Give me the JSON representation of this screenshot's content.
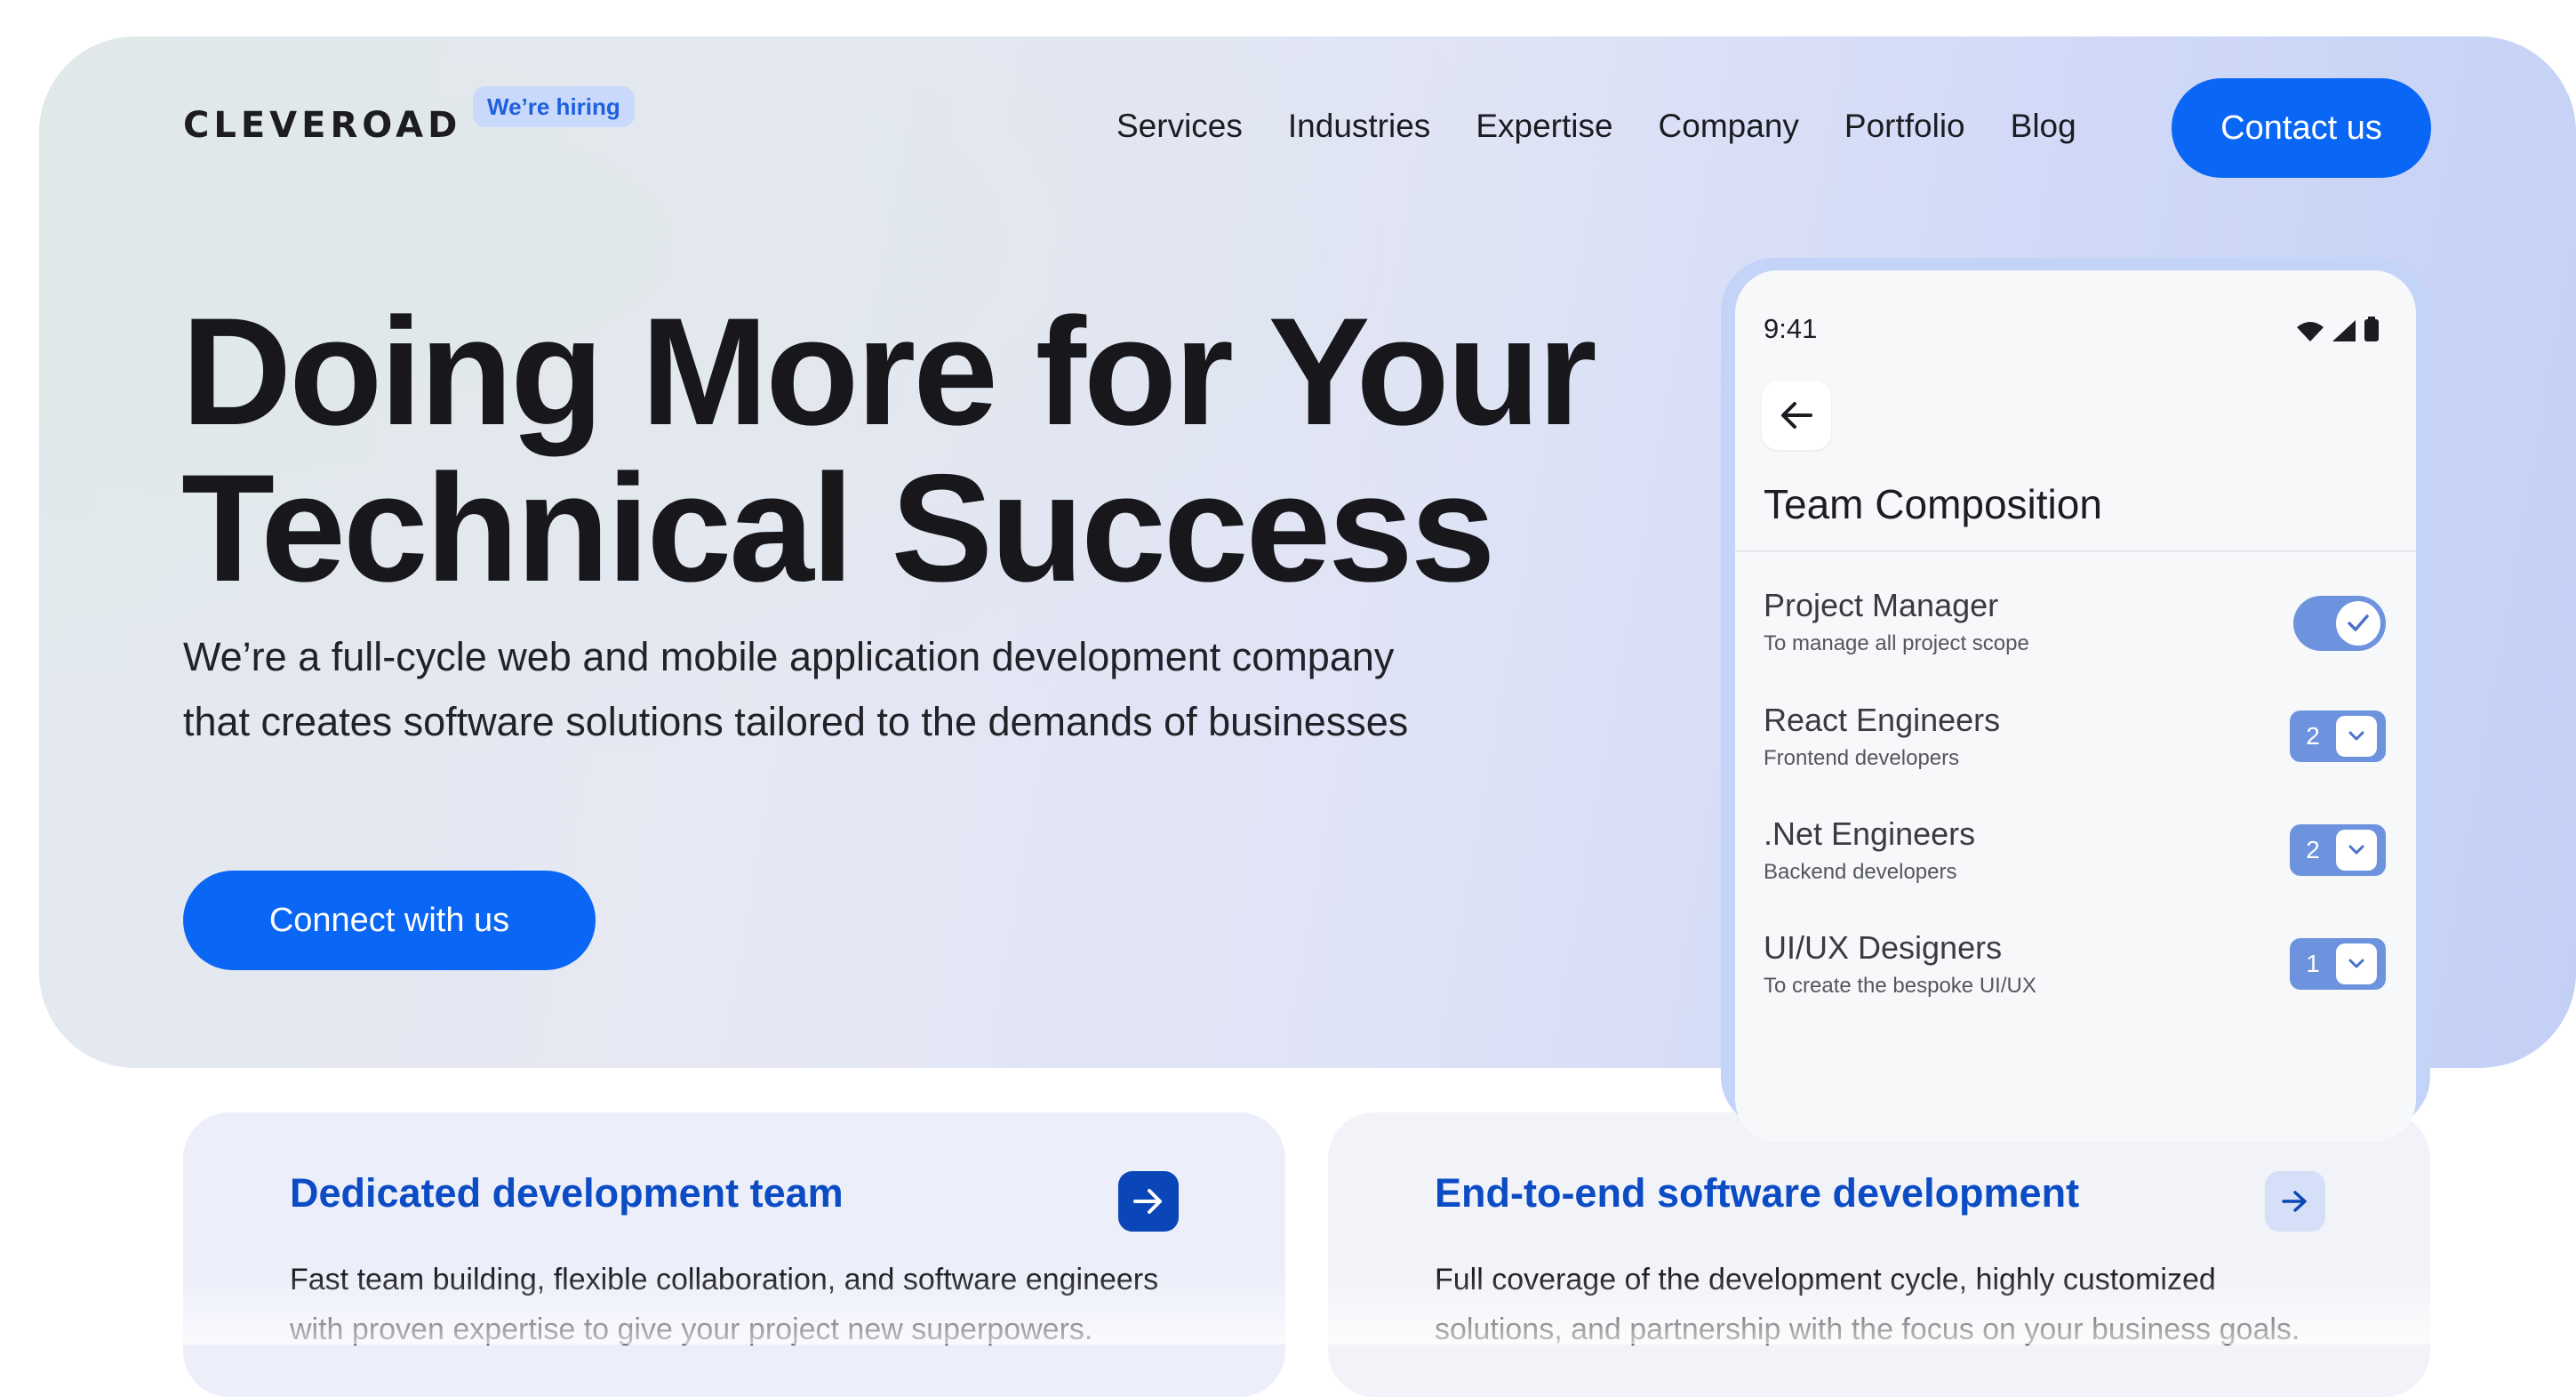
{
  "header": {
    "logo": "CLEVEROAD",
    "hiring_badge": "We’re hiring",
    "nav": [
      "Services",
      "Industries",
      "Expertise",
      "Company",
      "Portfolio",
      "Blog"
    ],
    "contact_label": "Contact us"
  },
  "hero": {
    "title_line1": "Doing More for Your",
    "title_line2": "Technical Success",
    "subtitle_line1": "We’re a full-cycle web and mobile application development company",
    "subtitle_line2": "that creates software solutions tailored to the demands of businesses",
    "cta_label": "Connect with us"
  },
  "phone": {
    "time": "9:41",
    "title": "Team Composition",
    "roles": [
      {
        "name": "Project Manager",
        "desc": "To manage all project scope",
        "control": "toggle",
        "checked": true
      },
      {
        "name": "React Engineers",
        "desc": "Frontend developers",
        "control": "stepper",
        "value": "2"
      },
      {
        "name": ".Net Engineers",
        "desc": "Backend developers",
        "control": "stepper",
        "value": "2"
      },
      {
        "name": "UI/UX Designers",
        "desc": "To create the bespoke UI/UX",
        "control": "stepper",
        "value": "1"
      }
    ]
  },
  "cards": [
    {
      "title": "Dedicated development team",
      "text_line1": "Fast team building, flexible collaboration, and software engineers",
      "text_line2": "with proven expertise to give your project new superpowers."
    },
    {
      "title": "End-to-end software development",
      "text_line1": "Full coverage of the development cycle, highly customized",
      "text_line2": "solutions, and partnership with the focus on your business goals."
    }
  ],
  "colors": {
    "accent": "#0a66f5",
    "card_title": "#0b4cc5",
    "toggle": "#6e93de"
  }
}
